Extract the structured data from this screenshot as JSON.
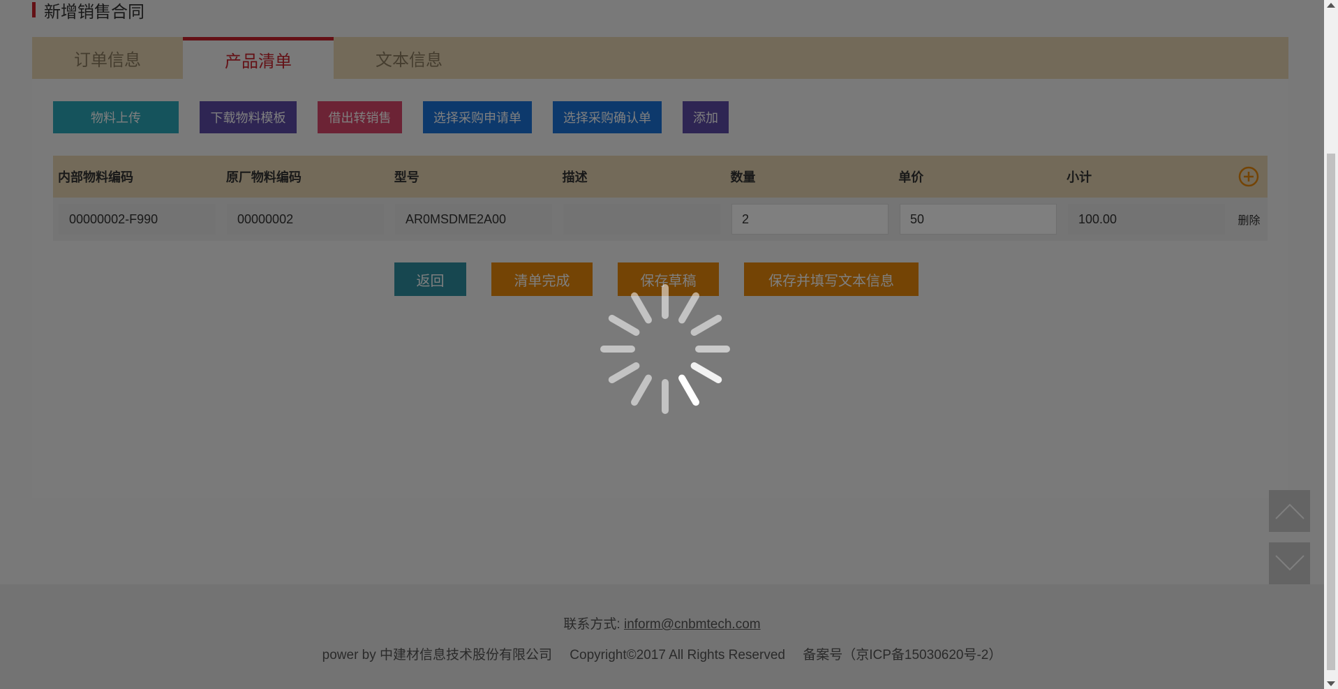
{
  "page": {
    "title": "新增销售合同"
  },
  "tabs": [
    {
      "label": "订单信息",
      "active": false
    },
    {
      "label": "产品清单",
      "active": true
    },
    {
      "label": "文本信息",
      "active": false
    }
  ],
  "toolbar": {
    "upload": "物料上传",
    "download_template": "下载物料模板",
    "borrow_to_sale": "借出转销售",
    "select_purchase_request": "选择采购申请单",
    "select_purchase_confirm": "选择采购确认单",
    "add": "添加"
  },
  "colors": {
    "teal": "#2ba6b8",
    "purple": "#5d4aa6",
    "pink": "#d9476a",
    "blue": "#1a73d9",
    "orange": "#e8890b",
    "return": "#2f8fa0",
    "accent_red": "#c8232c",
    "tab_bg": "#e6d5b3"
  },
  "table": {
    "headers": [
      "内部物料编码",
      "原厂物料编码",
      "型号",
      "描述",
      "数量",
      "单价",
      "小计"
    ],
    "add_icon": "plus-circle-icon",
    "rows": [
      {
        "internal_code": "00000002-F990",
        "factory_code": "00000002",
        "model": "AR0MSDME2A00",
        "description": "",
        "quantity": "2",
        "unit_price": "50",
        "subtotal": "100.00",
        "delete_label": "删除"
      }
    ]
  },
  "actions": {
    "back": "返回",
    "complete": "清单完成",
    "save_draft": "保存草稿",
    "save_and_fill": "保存并填写文本信息"
  },
  "footer": {
    "contact_label": "联系方式:",
    "contact_email": "inform@cnbmtech.com",
    "powered_by": "power by 中建材信息技术股份有限公司",
    "copyright": "Copyright©2017 All Rights Reserved",
    "icp": "备案号（京ICP备15030620号-2）"
  },
  "loading": {
    "icon": "loading-spinner-icon"
  }
}
